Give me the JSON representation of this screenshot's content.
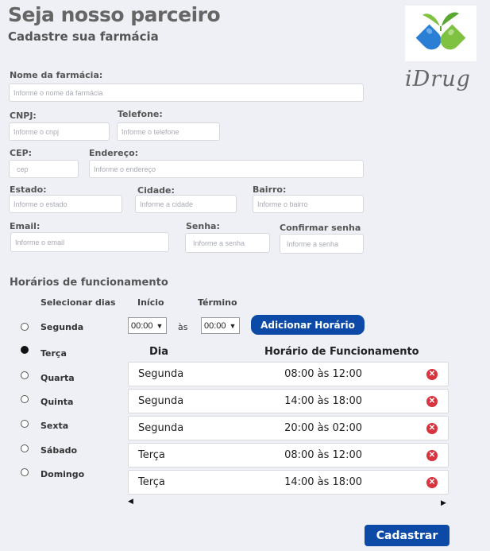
{
  "header": {
    "title": "Seja nosso parceiro",
    "subtitle": "Cadastre sua farmácia"
  },
  "brand": {
    "name": "iDrug",
    "logo_icon": "capsule-leaves-logo",
    "colors": {
      "blue": "#2a7fd4",
      "green": "#7fc241"
    }
  },
  "form": {
    "nome": {
      "label": "Nome da farmácia:",
      "placeholder": "Informe o nome da farmácia"
    },
    "cnpj": {
      "label": "CNPJ:",
      "placeholder": "Informe o cnpj"
    },
    "telefone": {
      "label": "Telefone:",
      "placeholder": "Informe o telefone"
    },
    "cep": {
      "label": "CEP:",
      "placeholder": "cep"
    },
    "endereco": {
      "label": "Endereço:",
      "placeholder": "Informe o endereço"
    },
    "estado": {
      "label": "Estado:",
      "placeholder": "Informe o estado"
    },
    "cidade": {
      "label": "Cidade:",
      "placeholder": "Informe a cidade"
    },
    "bairro": {
      "label": "Bairro:",
      "placeholder": "Informe o bairro"
    },
    "email": {
      "label": "Email:",
      "placeholder": "Informe o email"
    },
    "senha": {
      "label": "Senha:",
      "placeholder": "Informe a senha"
    },
    "confirmar": {
      "label": "Confirmar senha",
      "placeholder": "Informe a senha"
    }
  },
  "schedule": {
    "title": "Horários de funcionamento",
    "col_days": "Selecionar dias",
    "col_start": "Início",
    "col_end": "Término",
    "days": [
      {
        "label": "Segunda",
        "selected": false
      },
      {
        "label": "Terça",
        "selected": true
      },
      {
        "label": "Quarta",
        "selected": false
      },
      {
        "label": "Quinta",
        "selected": false
      },
      {
        "label": "Sexta",
        "selected": false
      },
      {
        "label": "Sábado",
        "selected": false
      },
      {
        "label": "Domingo",
        "selected": false
      }
    ],
    "start_value": "00:00",
    "end_value": "00:00",
    "separator": "às",
    "add_button": "Adicionar Horário",
    "table": {
      "headers": [
        "Dia",
        "Horário de Funcionamento"
      ],
      "rows": [
        {
          "day": "Segunda",
          "hours": "08:00 às 12:00"
        },
        {
          "day": "Segunda",
          "hours": "14:00 às 18:00"
        },
        {
          "day": "Segunda",
          "hours": "20:00 às 02:00"
        },
        {
          "day": "Terça",
          "hours": "08:00 às 12:00"
        },
        {
          "day": "Terça",
          "hours": "14:00 às 18:00"
        }
      ]
    }
  },
  "submit": "Cadastrar"
}
